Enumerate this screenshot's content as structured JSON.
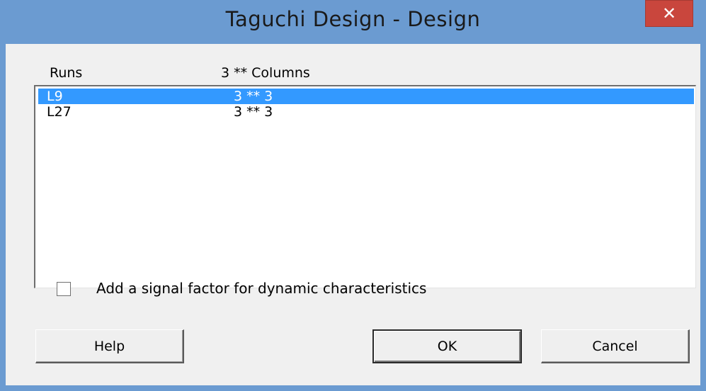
{
  "window": {
    "title": "Taguchi Design - Design",
    "close_glyph": "✕"
  },
  "list": {
    "headers": {
      "runs": "Runs",
      "columns": "3 ** Columns"
    },
    "rows": [
      {
        "runs": "L9",
        "columns": "3 ** 3",
        "selected": true
      },
      {
        "runs": "L27",
        "columns": "3 ** 3",
        "selected": false
      }
    ],
    "selection_color": "#3399ff"
  },
  "options": {
    "signal_factor_label": "Add a signal factor for dynamic characteristics",
    "signal_factor_checked": false
  },
  "buttons": {
    "help": "Help",
    "ok": "OK",
    "cancel": "Cancel"
  }
}
